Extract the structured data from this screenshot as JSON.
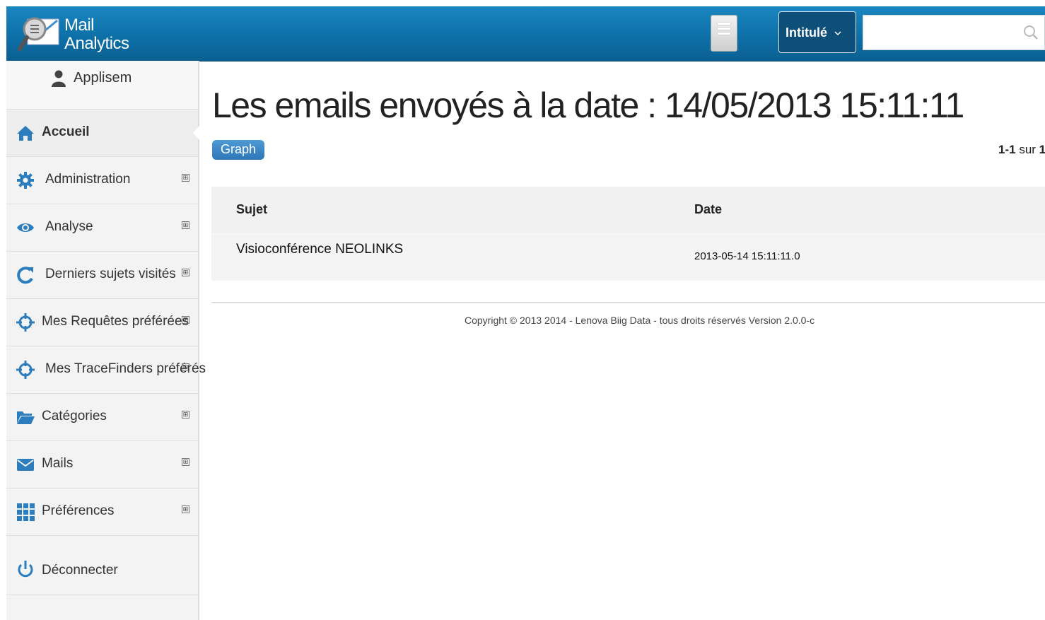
{
  "header": {
    "brand_line1": "Mail",
    "brand_line2": "Analytics",
    "select_label": "Intitulé",
    "search_placeholder": ""
  },
  "sidebar": {
    "user_name": "Applisem",
    "items": [
      {
        "label": "Accueil",
        "icon": "home-icon",
        "active": true
      },
      {
        "label": "Administration",
        "icon": "gear-icon"
      },
      {
        "label": "Analyse",
        "icon": "eye-icon"
      },
      {
        "label": "Derniers sujets visités",
        "icon": "refresh-icon"
      },
      {
        "label": "Mes Requêtes préférées",
        "icon": "crosshair-icon"
      },
      {
        "label": "Mes TraceFinders préférés",
        "icon": "crosshair-icon"
      },
      {
        "label": "Catégories",
        "icon": "folder-icon"
      },
      {
        "label": "Mails",
        "icon": "envelope-icon"
      },
      {
        "label": "Préférences",
        "icon": "grid-icon"
      },
      {
        "label": "Déconnecter",
        "icon": "power-icon"
      }
    ],
    "expand_symbol": "⊞"
  },
  "main": {
    "title": "Les emails envoyés à la date : 14/05/2013 15:11:11",
    "graph_button": "Graph",
    "pager": {
      "range": "1-1",
      "sep": "sur",
      "total": "1"
    },
    "table": {
      "headers": [
        "Sujet",
        "Date"
      ],
      "rows": [
        {
          "subject": "Visioconférence NEOLINKS",
          "date": "2013-05-14 15:11:11.0"
        }
      ]
    },
    "copyright": "Copyright © 2013 2014 - Lenova Biig Data - tous droits réservés Version 2.0.0-c"
  },
  "colors": {
    "header_bg": "#1a86c0",
    "accent": "#2d76b8",
    "sidebar_bg": "#f3f3f3"
  }
}
